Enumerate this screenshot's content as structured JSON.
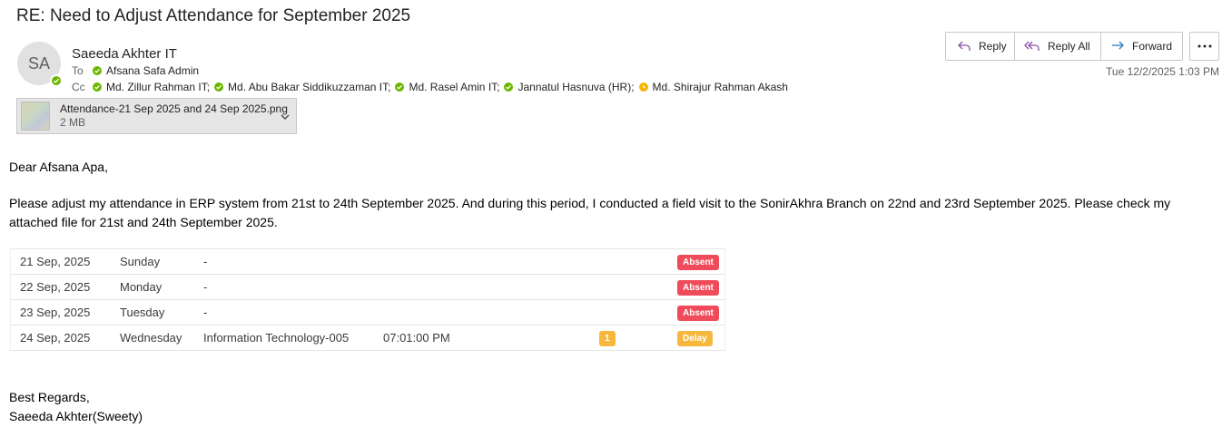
{
  "email": {
    "subject": "RE: Need to Adjust Attendance for September 2025",
    "sender": {
      "initials": "SA",
      "name": "Saeeda Akhter IT",
      "presence_color": "#6bb700"
    },
    "to_label": "To",
    "to": [
      {
        "name": "Afsana Safa Admin",
        "status": "available"
      }
    ],
    "cc_label": "Cc",
    "cc": [
      {
        "name": "Md. Zillur Rahman IT;",
        "status": "available"
      },
      {
        "name": "Md. Abu Bakar Siddikuzzaman IT;",
        "status": "available"
      },
      {
        "name": "Md. Rasel Amin IT;",
        "status": "available"
      },
      {
        "name": "Jannatul Hasnuva (HR);",
        "status": "available"
      },
      {
        "name": "Md. Shirajur Rahman Akash",
        "status": "away"
      }
    ],
    "timestamp": "Tue 12/2/2025 1:03 PM"
  },
  "attachment": {
    "name": "Attendance-21 Sep 2025 and 24 Sep 2025.png",
    "size": "2 MB"
  },
  "actions": {
    "reply": "Reply",
    "reply_all": "Reply All",
    "forward": "Forward"
  },
  "body": {
    "greeting": "Dear Afsana Apa,",
    "paragraph": "Please adjust my attendance in ERP system from 21st to 24th September 2025. And during this period, I conducted a field visit to the SonirAkhra Branch on 22nd and 23rd September 2025. Please check my attached file for 21st and 24th September 2025.",
    "regards": "Best Regards,",
    "signature": "Saeeda Akhter(Sweety)"
  },
  "attendance": [
    {
      "date": "21 Sep, 2025",
      "day": "Sunday",
      "dept": "-",
      "time": "",
      "count": "",
      "status": "Absent"
    },
    {
      "date": "22 Sep, 2025",
      "day": "Monday",
      "dept": "-",
      "time": "",
      "count": "",
      "status": "Absent"
    },
    {
      "date": "23 Sep, 2025",
      "day": "Tuesday",
      "dept": "-",
      "time": "",
      "count": "",
      "status": "Absent"
    },
    {
      "date": "24 Sep, 2025",
      "day": "Wednesday",
      "dept": "Information Technology-005",
      "time": "07:01:00 PM",
      "count": "1",
      "status": "Delay"
    }
  ],
  "colors": {
    "absent": "#f04b5a",
    "delay": "#f6b73c",
    "available": "#6bb700",
    "away": "#f4b400"
  },
  "icons": {
    "reply": "reply-arrow-icon",
    "reply_all": "reply-all-arrow-icon",
    "forward": "forward-arrow-icon",
    "more": "ellipsis-icon",
    "expand": "chevron-down-icon"
  }
}
